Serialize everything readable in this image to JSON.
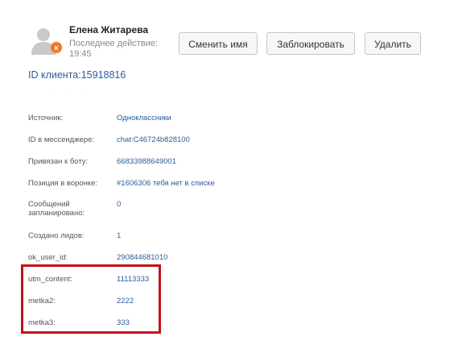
{
  "user": {
    "name": "Елена Житарева",
    "last_activity_label": "Последнее действие:",
    "last_activity_time": "19:45"
  },
  "avatar": {
    "icon": "user-icon",
    "badge_icon": "odnoklassniki-icon",
    "badge_color": "#f07a2a"
  },
  "buttons": {
    "rename": "Сменить имя",
    "block": "Заблокировать",
    "delete": "Удалить"
  },
  "client_id": "ID клиента:15918816",
  "faint_text": "· · ·",
  "fields": [
    {
      "label": "Источник:",
      "value": "Одноклассники"
    },
    {
      "label": "ID в мессенджере:",
      "value": "chat:C46724b828100"
    },
    {
      "label": "Привязан к боту:",
      "value": "66833988649001"
    },
    {
      "label": "Позиция в воронке:",
      "value": "#1606306 тебя нет в списке"
    },
    {
      "label": "Сообщений запланировано:",
      "value": "0"
    },
    {
      "label": "Создано лидов:",
      "value": "1"
    },
    {
      "label": "ok_user_id:",
      "value": "290844681010"
    },
    {
      "label": "utm_content:",
      "value": "11113333"
    },
    {
      "label": "metka2:",
      "value": "2222"
    },
    {
      "label": "metka3:",
      "value": "333"
    }
  ],
  "colors": {
    "link": "#2a5d9a",
    "highlight": "#c0131a"
  }
}
